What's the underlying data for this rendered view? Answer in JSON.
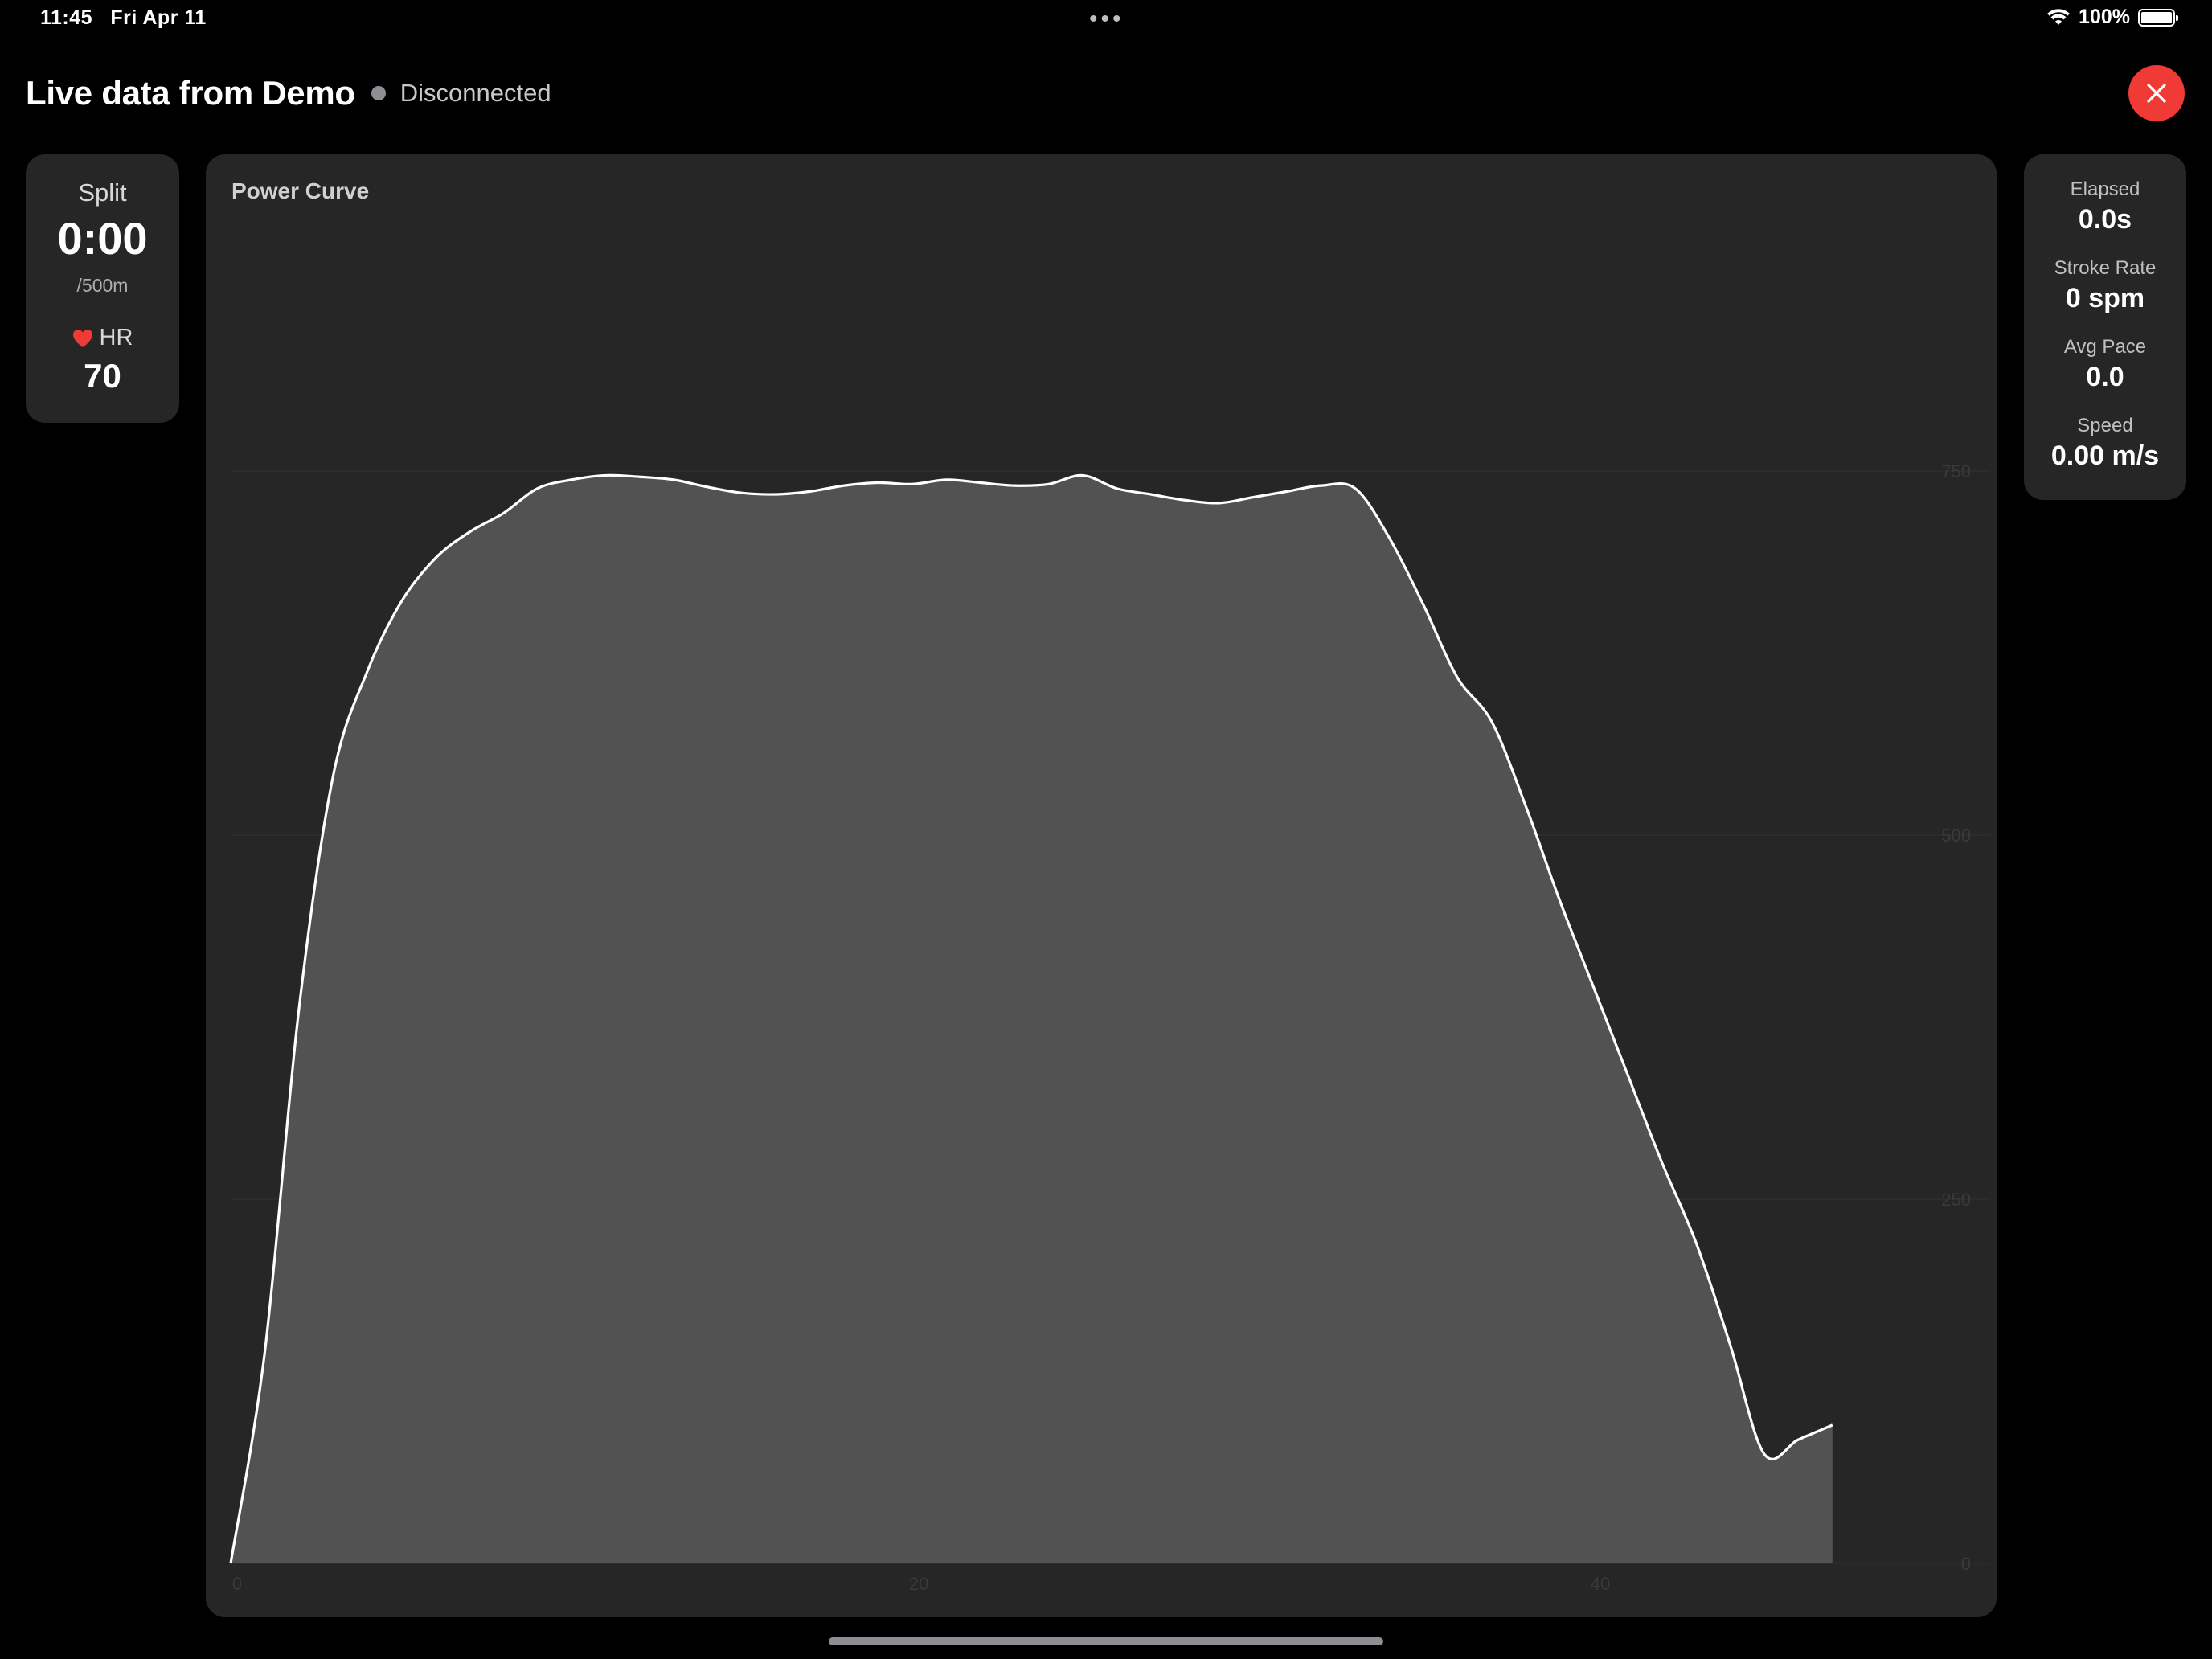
{
  "status_bar": {
    "time": "11:45",
    "date": "Fri Apr 11",
    "battery": "100%",
    "multitask": "•••"
  },
  "header": {
    "title": "Live data from Demo",
    "connection_status": "Disconnected",
    "close_icon": "close-icon"
  },
  "colors": {
    "accent_close": "#ef3a36",
    "heart": "#ef3a36",
    "status_dot": "#8e8e93",
    "card": "#262626"
  },
  "left_panel": {
    "split_label": "Split",
    "split_value": "0:00",
    "split_unit": "/500m",
    "hr_label": "HR",
    "hr_value": "70"
  },
  "right_panel": [
    {
      "label": "Elapsed",
      "value": "0.0s"
    },
    {
      "label": "Stroke Rate",
      "value": "0 spm"
    },
    {
      "label": "Avg Pace",
      "value": "0.0"
    },
    {
      "label": "Speed",
      "value": "0.00 m/s"
    }
  ],
  "chart_data": {
    "type": "area",
    "title": "Power Curve",
    "xlabel": "",
    "ylabel": "",
    "xlim": [
      0,
      50
    ],
    "ylim": [
      0,
      750
    ],
    "x_ticks": [
      0,
      20,
      40
    ],
    "y_ticks": [
      0,
      250,
      500,
      750
    ],
    "grid": true,
    "series": [
      {
        "x": [
          0,
          1,
          2,
          3,
          4,
          5,
          6,
          7,
          8,
          9,
          10,
          11,
          12,
          13,
          14,
          15,
          16,
          17,
          18,
          19,
          20,
          21,
          22,
          23,
          24,
          25,
          26,
          27,
          28,
          29,
          30,
          31,
          32,
          33,
          34,
          35,
          36,
          37,
          38,
          39,
          40,
          41,
          42,
          43,
          44,
          45,
          46,
          47
        ],
        "values": [
          0,
          145,
          380,
          540,
          612,
          660,
          690,
          708,
          721,
          738,
          744,
          747,
          746,
          744,
          739,
          735,
          734,
          736,
          740,
          742,
          741,
          744,
          742,
          740,
          741,
          747,
          738,
          734,
          730,
          728,
          732,
          736,
          740,
          738,
          704,
          658,
          608,
          578,
          520,
          455,
          395,
          335,
          275,
          220,
          150,
          75,
          85,
          95
        ]
      }
    ]
  }
}
